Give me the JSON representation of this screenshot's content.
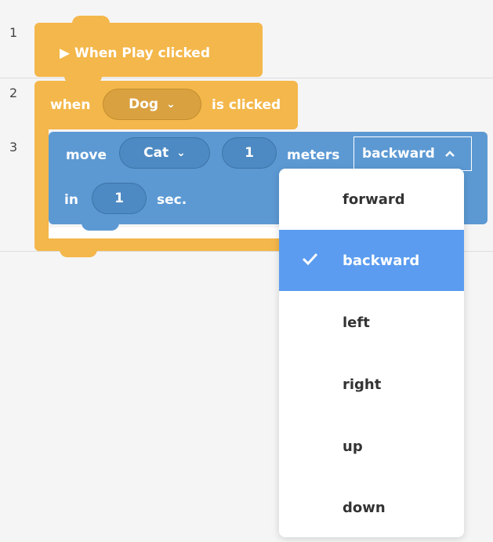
{
  "line_numbers": [
    "1",
    "2",
    "3"
  ],
  "block_play": {
    "label": "▶ When Play clicked"
  },
  "block_when": {
    "prefix": "when",
    "sprite": "Dog",
    "suffix": "is clicked"
  },
  "block_move": {
    "prefix": "move",
    "sprite": "Cat",
    "distance": "1",
    "unit": "meters",
    "direction": "backward",
    "in_label": "in",
    "seconds": "1",
    "sec_label": "sec."
  },
  "dropdown": {
    "options": [
      "forward",
      "backward",
      "left",
      "right",
      "up",
      "down"
    ],
    "selected": "backward"
  },
  "colors": {
    "event_block": "#f4b74b",
    "motion_block": "#5c99d3",
    "selected_option": "#5b9cf0"
  },
  "icons": {
    "chevron_down": "chevron-down-icon",
    "chevron_up": "chevron-up-icon",
    "check": "check-icon",
    "play": "play-icon"
  }
}
